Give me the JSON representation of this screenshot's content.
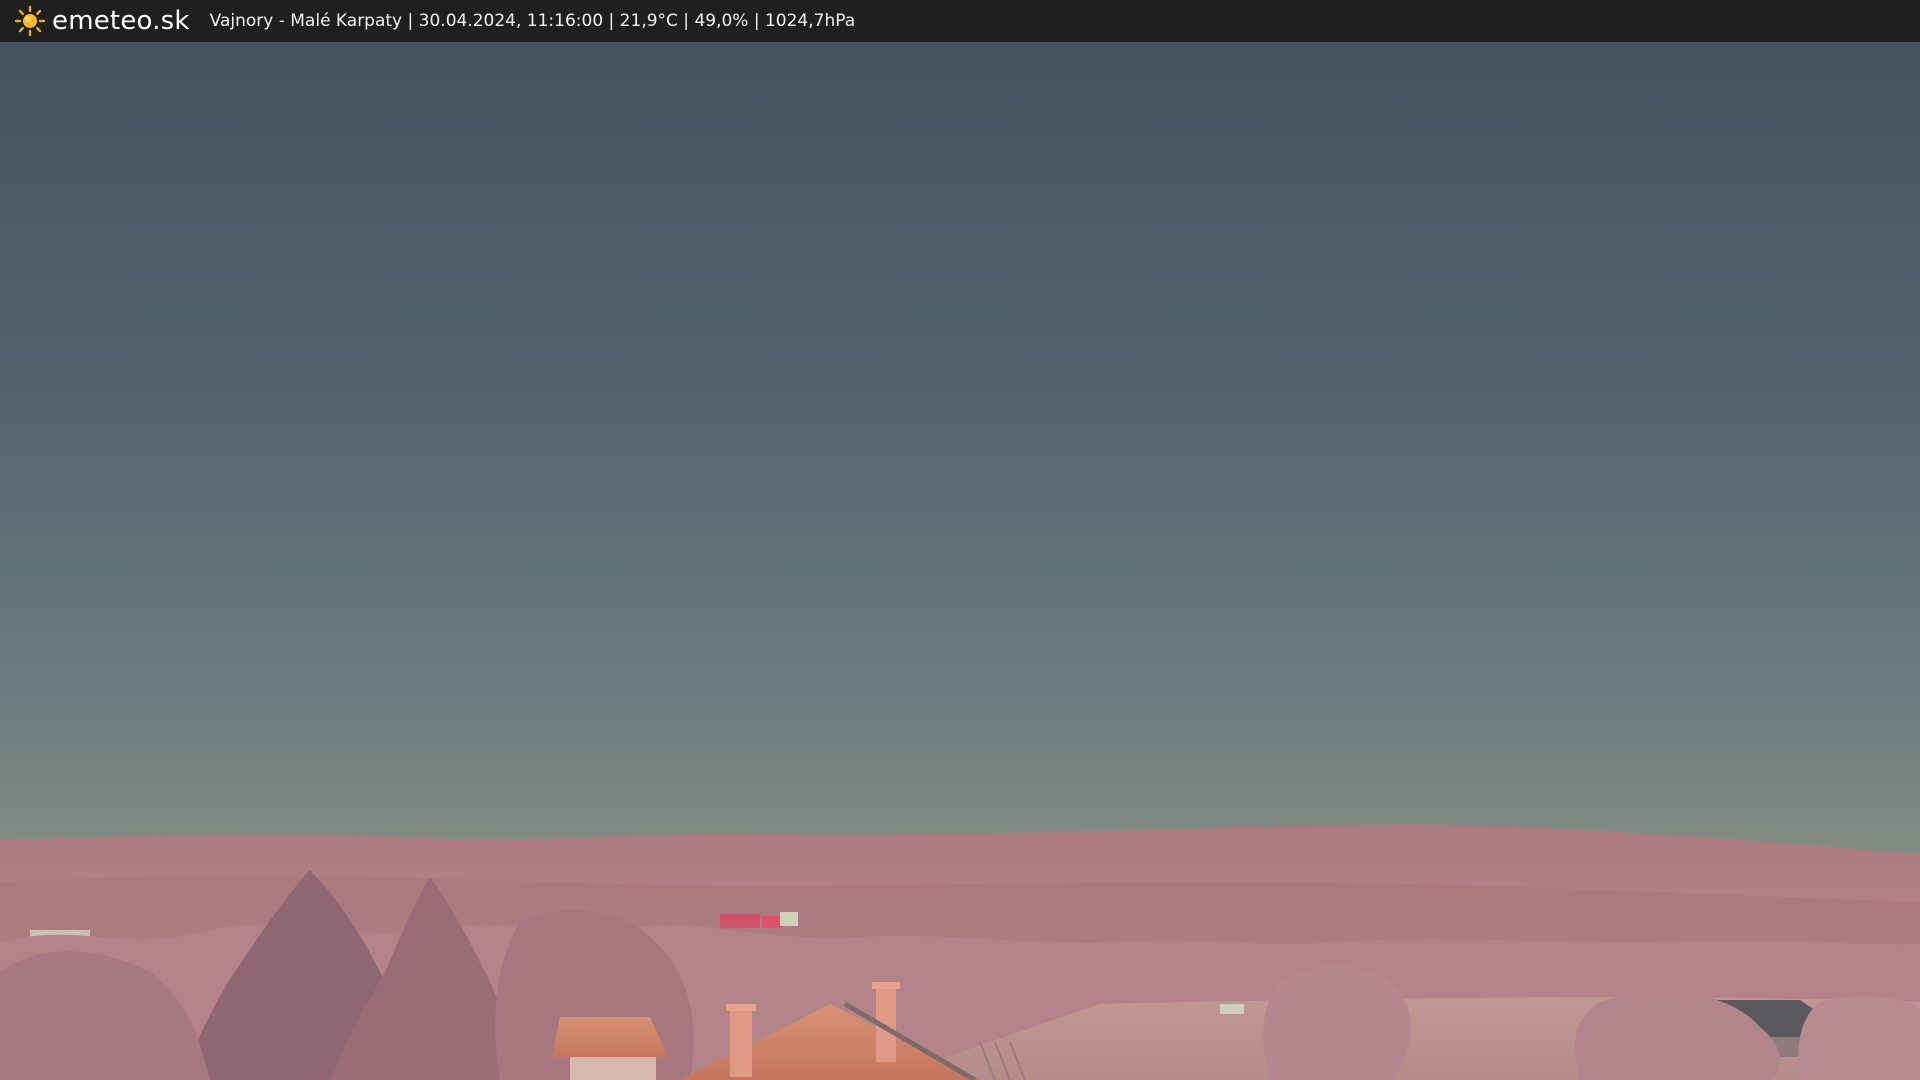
{
  "header": {
    "brand": "emeteo.sk",
    "status_line": "Vajnory - Malé Karpaty | 30.04.2024, 11:16:00 | 21,9°C | 49,0% | 1024,7hPa",
    "logo_icon": "sun-icon"
  },
  "colors": {
    "bar_bg": "#1f1f1f",
    "sun": "#f5a623",
    "sky_top": "#46525f",
    "sky_bottom": "#8c8f83",
    "hills": "#b88a8c",
    "foliage": "#b07f86",
    "roof": "#d1836a"
  }
}
